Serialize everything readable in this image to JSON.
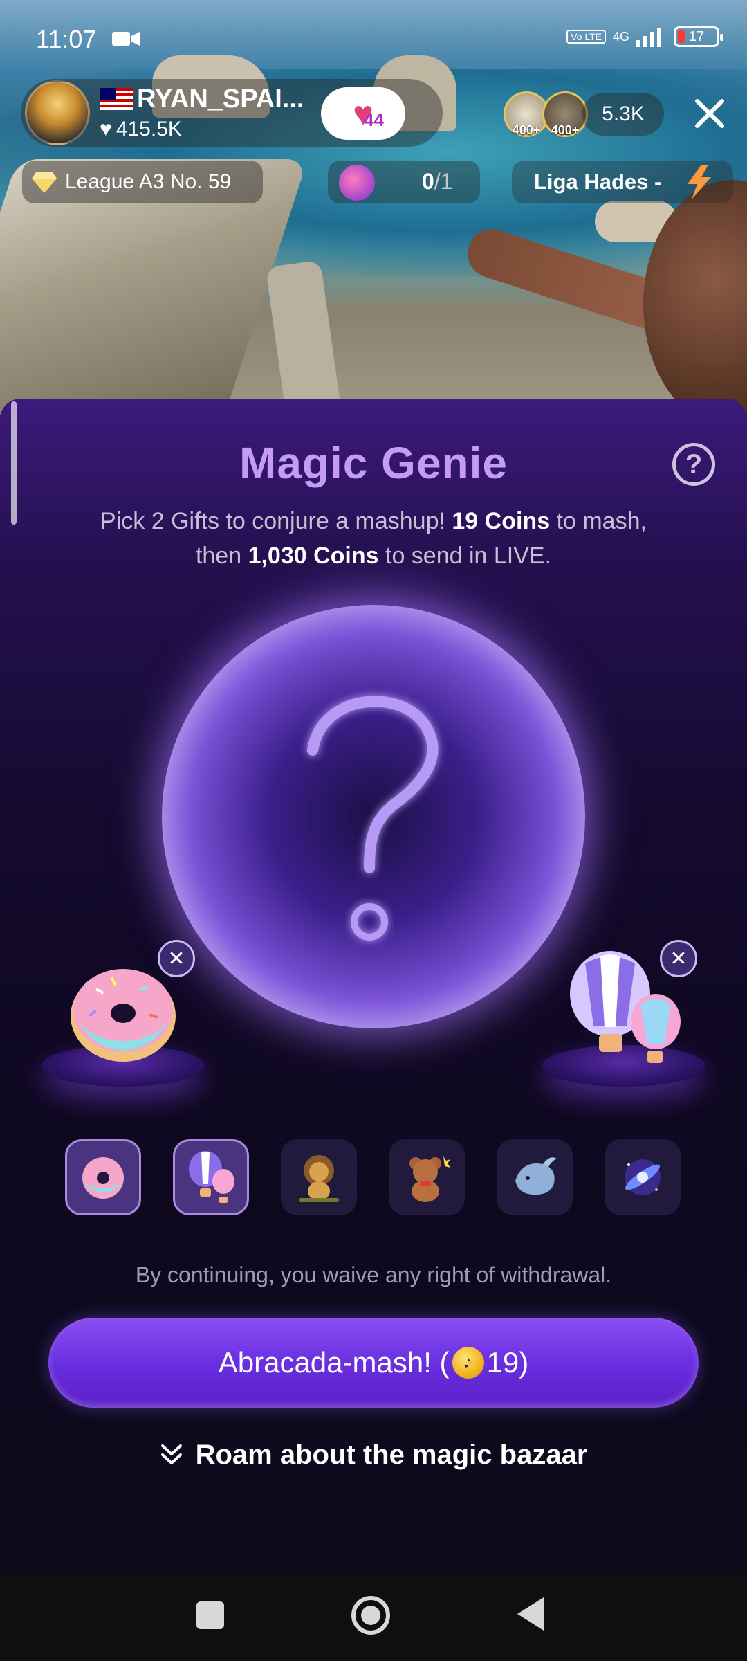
{
  "status_bar": {
    "time": "11:07",
    "network": "4G",
    "volte": "Vo LTE",
    "battery": "17"
  },
  "live_header": {
    "host_name": "RYAN_SPAI...",
    "host_likes": "415.5K",
    "fan_level": "44",
    "viewer_badges": [
      "400+",
      "400+"
    ],
    "viewer_count": "5.3K",
    "league": "League A3 No. 59",
    "mission_progress": "0",
    "mission_total": "/1",
    "league_name": "Liga Hades -"
  },
  "sheet": {
    "title": "Magic Genie",
    "help": "?",
    "sub_part1": "Pick 2 Gifts to conjure a mashup! ",
    "sub_coins1": "19 Coins",
    "sub_part2": " to mash,",
    "sub_part3": "then ",
    "sub_coins2": "1,030 Coins",
    "sub_part4": " to send in LIVE.",
    "left_gift": "donut-gift",
    "right_gift": "hot-air-balloon-gift",
    "gift_options": [
      {
        "name": "donut",
        "selected": true
      },
      {
        "name": "hot-air-balloon",
        "selected": true
      },
      {
        "name": "lion",
        "selected": false
      },
      {
        "name": "teddy-bear",
        "selected": false
      },
      {
        "name": "whale",
        "selected": false
      },
      {
        "name": "galaxy",
        "selected": false
      }
    ],
    "waiver": "By continuing, you waive any right of withdrawal.",
    "mash_label_pre": "Abracada-mash! (",
    "mash_cost": "19",
    "mash_label_post": ")",
    "roam_label": "Roam about the magic bazaar"
  },
  "colors": {
    "title": "#c59cf3",
    "button": "#6a2fe0",
    "sheet_bg": "#140a2e"
  }
}
